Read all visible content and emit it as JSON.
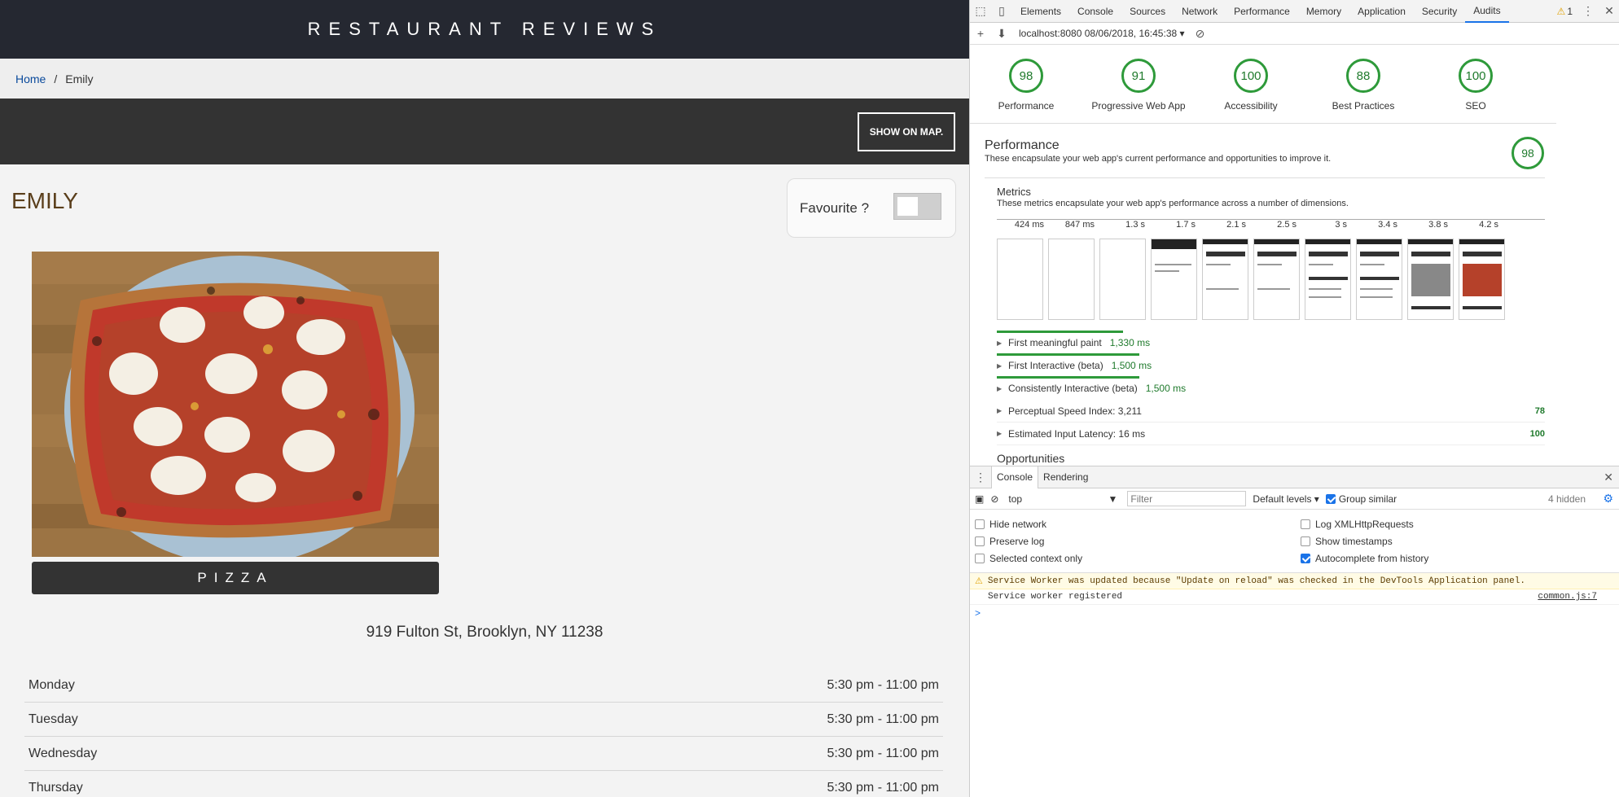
{
  "app": {
    "title": "RESTAURANT REVIEWS",
    "breadcrumb": {
      "home": "Home",
      "separator": "/",
      "current": "Emily"
    },
    "map_button": "SHOW ON MAP.",
    "restaurant": {
      "name": "EMILY",
      "favourite_label": "Favourite ?",
      "favourite_on": false,
      "cuisine": "PIZZA",
      "address": "919 Fulton St, Brooklyn, NY 11238",
      "hours": [
        {
          "day": "Monday",
          "time": "5:30 pm - 11:00 pm"
        },
        {
          "day": "Tuesday",
          "time": "5:30 pm - 11:00 pm"
        },
        {
          "day": "Wednesday",
          "time": "5:30 pm - 11:00 pm"
        },
        {
          "day": "Thursday",
          "time": "5:30 pm - 11:00 pm"
        }
      ]
    }
  },
  "devtools": {
    "tabs": [
      "Elements",
      "Console",
      "Sources",
      "Network",
      "Performance",
      "Memory",
      "Application",
      "Security",
      "Audits"
    ],
    "active_tab": "Audits",
    "warning_count": "1",
    "report_label": "localhost:8080 08/06/2018, 16:45:38",
    "gauges": [
      {
        "score": "98",
        "label": "Performance"
      },
      {
        "score": "91",
        "label": "Progressive Web App"
      },
      {
        "score": "100",
        "label": "Accessibility"
      },
      {
        "score": "88",
        "label": "Best Practices"
      },
      {
        "score": "100",
        "label": "SEO"
      }
    ],
    "performance": {
      "title": "Performance",
      "desc": "These encapsulate your web app's current performance and opportunities to improve it.",
      "score": "98"
    },
    "metrics": {
      "title": "Metrics",
      "desc": "These metrics encapsulate your web app's performance across a number of dimensions.",
      "timeline": [
        "424 ms",
        "847 ms",
        "1.3 s",
        "1.7 s",
        "2.1 s",
        "2.5 s",
        "3 s",
        "3.4 s",
        "3.8 s",
        "4.2 s"
      ],
      "rows": [
        {
          "label": "First meaningful paint",
          "value": "1,330 ms",
          "score": "",
          "bar_fraction": 0.23
        },
        {
          "label": "First Interactive (beta)",
          "value": "1,500 ms",
          "score": "",
          "bar_fraction": 0.26
        },
        {
          "label": "Consistently Interactive (beta)",
          "value": "1,500 ms",
          "score": "",
          "bar_fraction": 0.26
        },
        {
          "label": "Perceptual Speed Index: 3,211",
          "value": "",
          "score": "78",
          "bar_fraction": 0
        },
        {
          "label": "Estimated Input Latency: 16 ms",
          "value": "",
          "score": "100",
          "bar_fraction": 0
        }
      ]
    },
    "opportunities": "Opportunities",
    "drawer": {
      "tabs": [
        "Console",
        "Rendering"
      ],
      "context": "top",
      "filter_placeholder": "Filter",
      "levels": "Default levels",
      "group_similar": "Group similar",
      "hidden": "4 hidden",
      "options_left": [
        {
          "label": "Hide network",
          "checked": false
        },
        {
          "label": "Preserve log",
          "checked": false
        },
        {
          "label": "Selected context only",
          "checked": false
        }
      ],
      "options_right": [
        {
          "label": "Log XMLHttpRequests",
          "checked": false
        },
        {
          "label": "Show timestamps",
          "checked": false
        },
        {
          "label": "Autocomplete from history",
          "checked": true
        }
      ],
      "warning_msg": "Service Worker was updated because \"Update on reload\" was checked in the DevTools Application panel.",
      "log_msg": "Service worker registered",
      "log_src": "common.js:7",
      "prompt": ">"
    }
  }
}
